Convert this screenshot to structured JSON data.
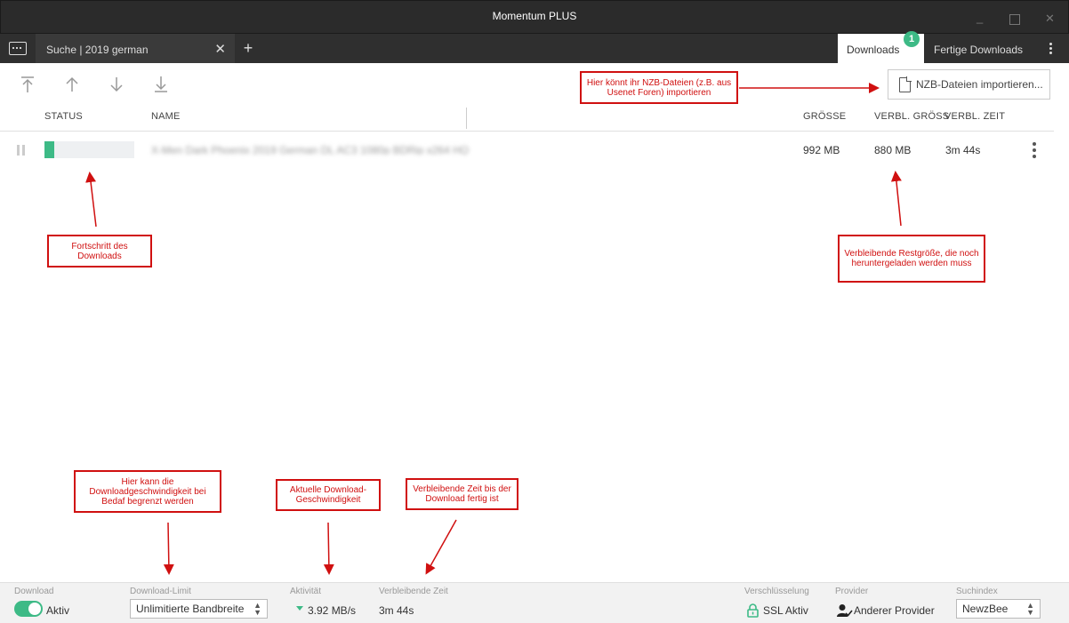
{
  "window": {
    "title": "Momentum PLUS"
  },
  "tabs": {
    "search_tab": "Suche | 2019 german",
    "downloads_tab": "Downloads",
    "downloads_badge": "1",
    "finished_tab": "Fertige Downloads"
  },
  "toolbar": {
    "import_button": "NZB-Dateien importieren..."
  },
  "table": {
    "headers": {
      "status": "STATUS",
      "name": "NAME",
      "size": "GRÖSSE",
      "remaining_size": "VERBL. GRÖSS",
      "remaining_time": "VERBL. ZEIT"
    },
    "rows": [
      {
        "name": "X-Men Dark Phoenix 2019 German DL AC3 1080p BDRip x264 HQ",
        "progress": 0.11,
        "size": "992 MB",
        "remaining_size": "880 MB",
        "remaining_time": "3m 44s"
      }
    ]
  },
  "annotations": {
    "import": "Hier könnt ihr NZB-Dateien (z.B. aus Usenet Foren) importieren",
    "progress": "Fortschritt des Downloads",
    "remaining": "Verbleibende Restgröße, die noch heruntergeladen werden muss",
    "limit": "Hier kann die Downloadgeschwindigkeit bei Bedaf begrenzt werden",
    "speed": "Aktuelle Download-Geschwindigkeit",
    "time": "Verbleibende Zeit bis der Download fertig ist"
  },
  "statusbar": {
    "download_label": "Download",
    "download_value": "Aktiv",
    "limit_label": "Download-Limit",
    "limit_value": "Unlimitierte Bandbreite",
    "activity_label": "Aktivität",
    "activity_value": "3.92 MB/s",
    "remaining_label": "Verbleibende Zeit",
    "remaining_value": "3m 44s",
    "encryption_label": "Verschlüsselung",
    "encryption_value": "SSL Aktiv",
    "provider_label": "Provider",
    "provider_value": "Anderer Provider",
    "index_label": "Suchindex",
    "index_value": "NewzBee"
  },
  "colors": {
    "accent": "#3dba86",
    "annotation": "#d01010",
    "titlebar": "#2b2b2b"
  }
}
